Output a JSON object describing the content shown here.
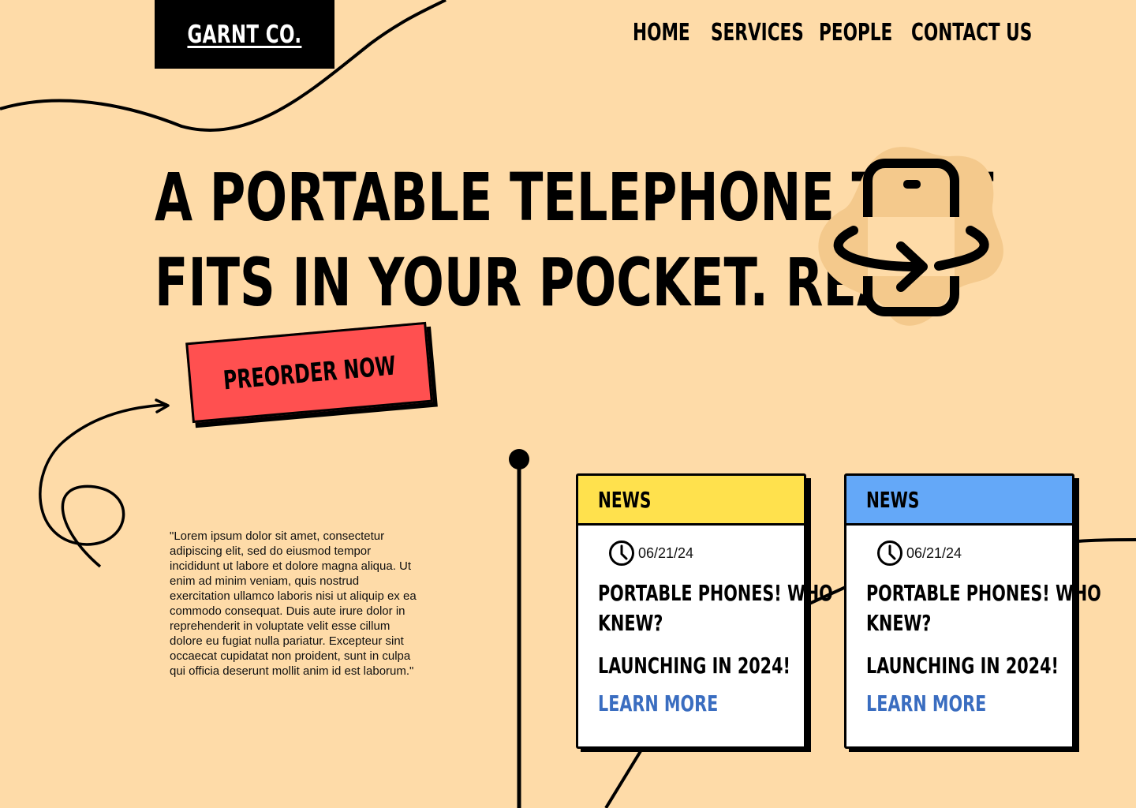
{
  "brand": {
    "name": "GARNT CO."
  },
  "nav": {
    "items": [
      {
        "label": "HOME"
      },
      {
        "label": "SERVICES"
      },
      {
        "label": "PEOPLE"
      },
      {
        "label": "CONTACT US"
      }
    ]
  },
  "hero": {
    "line1": "A PORTABLE TELEPHONE THAT",
    "line2": "FITS IN YOUR POCKET. REALY",
    "icon": "phone-rotate-icon"
  },
  "cta": {
    "label": "PREORDER NOW"
  },
  "quote": {
    "text": "\"Lorem ipsum dolor sit amet, consectetur adipiscing elit, sed do eiusmod tempor incididunt ut labore et dolore magna aliqua. Ut enim ad minim veniam, quis nostrud exercitation ullamco laboris nisi ut aliquip ex ea commodo consequat. Duis aute irure dolor in reprehenderit in voluptate velit esse cillum dolore eu fugiat nulla pariatur. Excepteur sint occaecat cupidatat non proident, sunt in culpa qui officia deserunt mollit anim id est laborum.\""
  },
  "cards": [
    {
      "tag": "NEWS",
      "header_color": "#FFE14D",
      "date": "06/21/24",
      "title_line1": "PORTABLE PHONES! WHO",
      "title_line2": "KNEW?",
      "subtitle": "LAUNCHING IN 2024!",
      "link": "LEARN MORE"
    },
    {
      "tag": "NEWS",
      "header_color": "#64A8F8",
      "date": "06/21/24",
      "title_line1": "PORTABLE PHONES! WHO",
      "title_line2": "KNEW?",
      "subtitle": "LAUNCHING IN 2024!",
      "link": "LEARN MORE"
    }
  ],
  "colors": {
    "background": "#FEDBA8",
    "cta": "#FF5050",
    "link": "#3A6DC0",
    "blob": "#F4C98C"
  }
}
